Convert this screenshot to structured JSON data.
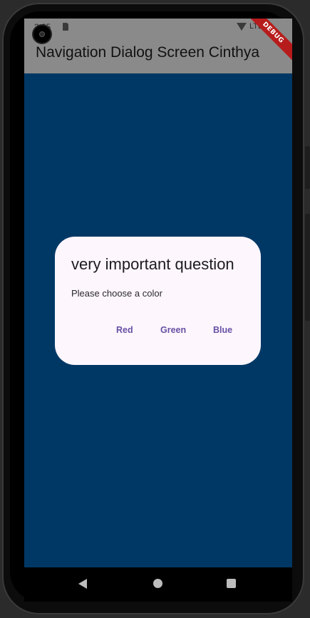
{
  "status_bar": {
    "time": "3:25",
    "network": "LTE",
    "icons": [
      "sim-card-icon",
      "wifi-icon",
      "signal-icon"
    ]
  },
  "app_bar": {
    "title": "Navigation Dialog Screen Cinthya",
    "debug_banner": "DEBUG"
  },
  "dialog": {
    "title": "very important question",
    "content": "Please choose a color",
    "actions": [
      "Red",
      "Green",
      "Blue"
    ]
  },
  "nav_bar": {
    "icons": [
      "back-icon",
      "home-icon",
      "recents-icon"
    ]
  },
  "colors": {
    "body_background": "#003865",
    "app_bar": "#8a8a8a",
    "dialog_surface": "#fdf6fd",
    "dialog_action": "#6750a4",
    "debug_banner": "#b71c1c"
  }
}
